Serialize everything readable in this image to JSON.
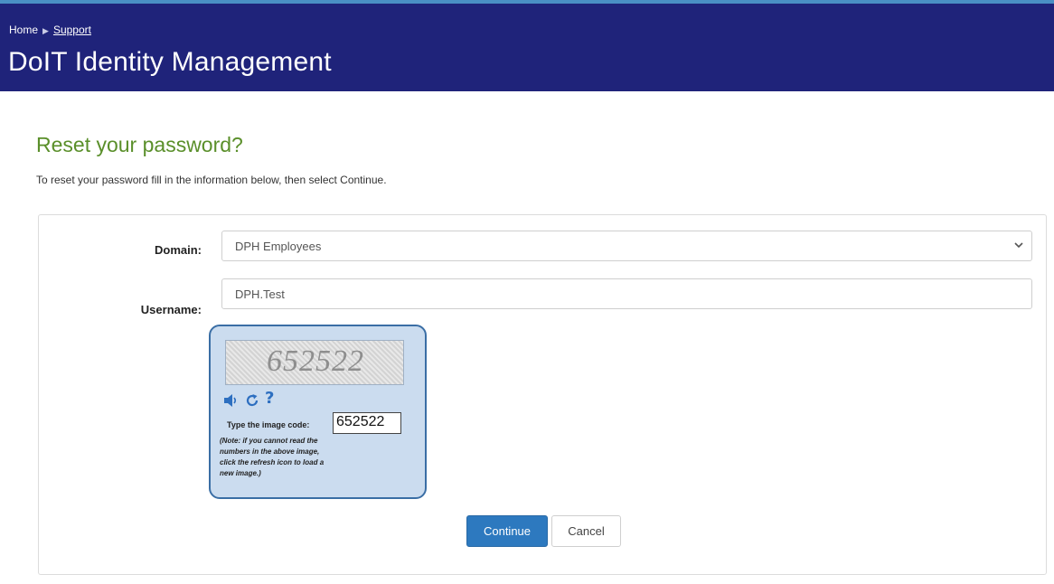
{
  "header": {
    "breadcrumb": {
      "home": "Home",
      "separator": "▶",
      "support": "Support"
    },
    "title": "DoIT Identity Management"
  },
  "page": {
    "heading": "Reset your password?",
    "intro": "To reset your password fill in the information below, then select Continue."
  },
  "form": {
    "domain_label": "Domain:",
    "domain_value": "DPH Employees",
    "username_label": "Username:",
    "username_value": "DPH.Test"
  },
  "captcha": {
    "image_code": "652522",
    "icons": [
      "speaker-icon",
      "refresh-icon",
      "help-icon"
    ],
    "help_glyph": "?",
    "prompt": "Type the image code:",
    "input_value": "652522",
    "note": "(Note: if you cannot read the numbers in the above image, click the refresh icon to load a new image.)"
  },
  "actions": {
    "continue": "Continue",
    "cancel": "Cancel"
  },
  "colors": {
    "header_bg": "#1f237a",
    "heading": "#5a8f2a",
    "primary_button": "#2d79bf",
    "captcha_bg": "#cbdcef",
    "captcha_border": "#3a6ea5"
  }
}
